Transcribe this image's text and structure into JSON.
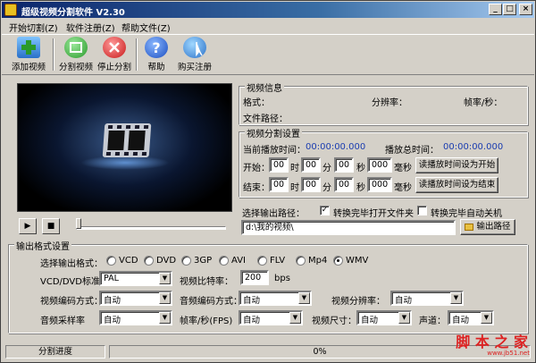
{
  "window": {
    "title": "超级视频分割软件 V2.30",
    "minimize": "_",
    "maximize": "□",
    "close": "×"
  },
  "menu": [
    "开始切割(Z)",
    "软件注册(Z)",
    "帮助文件(Z)"
  ],
  "toolbar": {
    "add_video": "添加视频",
    "split_video": "分割视频",
    "stop_split": "停止分割",
    "help": "帮助",
    "buy_register": "购买注册"
  },
  "player": {
    "play": "▶",
    "stop": "■",
    "progress": 0
  },
  "video_info": {
    "title": "视频信息",
    "format_label": "格式：",
    "resolution_label": "分辨率：",
    "fps_label": "帧率/秒：",
    "path_label": "文件路径："
  },
  "split_settings": {
    "title": "视频分割设置",
    "current_time_label": "当前播放时间：",
    "current_time": "00:00:00.000",
    "total_time_label": "播放总时间：",
    "total_time": "00:00:00.000",
    "start_label": "开始：",
    "end_label": "结束：",
    "hour": "时",
    "minute": "分",
    "second": "秒",
    "ms": "毫秒",
    "start": {
      "h": "00",
      "m": "00",
      "s": "00",
      "ms": "000"
    },
    "end": {
      "h": "00",
      "m": "00",
      "s": "00",
      "ms": "000"
    },
    "set_start_button": "读播放时间设为开始",
    "set_end_button": "读播放时间设为结束"
  },
  "output_path": {
    "label": "选择输出路径：",
    "open_folder_label": "转换完毕打开文件夹",
    "open_folder_checked": true,
    "shutdown_label": "转换完毕自动关机",
    "shutdown_checked": false,
    "path": "d:\\我的视频\\",
    "output_button": "输出路径"
  },
  "output_format": {
    "title": "输出格式设置",
    "select_label": "选择输出格式：",
    "formats": [
      "VCD",
      "DVD",
      "3GP",
      "AVI",
      "FLV",
      "Mp4",
      "WMV"
    ],
    "selected": "WMV",
    "vcd_std_label": "VCD/DVD标准：",
    "vcd_std": "PAL",
    "video_bitrate_label": "视频比特率：",
    "video_bitrate": "200",
    "bps": "bps",
    "video_codec_label": "视频编码方式：",
    "video_codec": "自动",
    "audio_codec_label": "音频编码方式：",
    "audio_codec": "自动",
    "video_res_label": "视频分辨率：",
    "video_res": "自动",
    "audio_rate_label": "音频采样率",
    "audio_rate": "自动",
    "fps_label": "帧率/秒(FPS)",
    "fps": "自动",
    "video_size_label": "视频尺寸：",
    "video_size": "自动",
    "channel_label": "声道：",
    "channel": "自动"
  },
  "status": {
    "label": "分割进度",
    "percent": "0%"
  },
  "watermark": {
    "text": "脚 本 之 家",
    "url": "www.jb51.net"
  }
}
